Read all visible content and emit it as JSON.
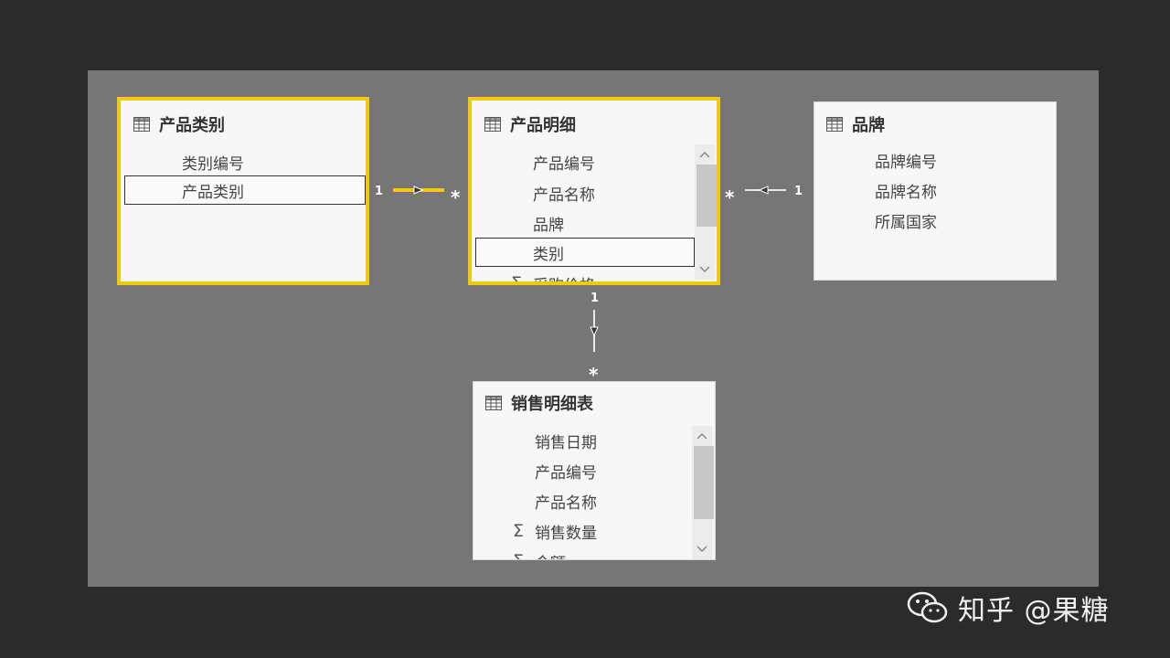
{
  "tables": {
    "category": {
      "title": "产品类别",
      "fields": [
        {
          "label": "类别编号",
          "sigma": false
        },
        {
          "label": "产品类别",
          "sigma": false
        }
      ]
    },
    "detail": {
      "title": "产品明细",
      "fields": [
        {
          "label": "产品编号",
          "sigma": false
        },
        {
          "label": "产品名称",
          "sigma": false
        },
        {
          "label": "品牌",
          "sigma": false
        },
        {
          "label": "类别",
          "sigma": false
        },
        {
          "label": "采购价格",
          "sigma": true
        }
      ]
    },
    "brand": {
      "title": "品牌",
      "fields": [
        {
          "label": "品牌编号",
          "sigma": false
        },
        {
          "label": "品牌名称",
          "sigma": false
        },
        {
          "label": "所属国家",
          "sigma": false
        }
      ]
    },
    "sales": {
      "title": "销售明细表",
      "fields": [
        {
          "label": "销售日期",
          "sigma": false
        },
        {
          "label": "产品编号",
          "sigma": false
        },
        {
          "label": "产品名称",
          "sigma": false
        },
        {
          "label": "销售数量",
          "sigma": true
        },
        {
          "label": "金额",
          "sigma": true
        }
      ]
    }
  },
  "relationships": {
    "category_detail": {
      "one": "1",
      "many": "*"
    },
    "brand_detail": {
      "one": "1",
      "many": "*"
    },
    "detail_sales": {
      "one": "1",
      "many": "*"
    }
  },
  "icons": {
    "table": "table-grid-icon",
    "sum": "sigma-icon",
    "scroll_up": "chevron-up-icon",
    "scroll_down": "chevron-down-icon",
    "wechat": "wechat-icon"
  },
  "colors": {
    "selection": "#f2c811",
    "canvas": "#767676",
    "background": "#2b2b2b"
  },
  "watermark": {
    "text": "知乎 @果糖"
  }
}
